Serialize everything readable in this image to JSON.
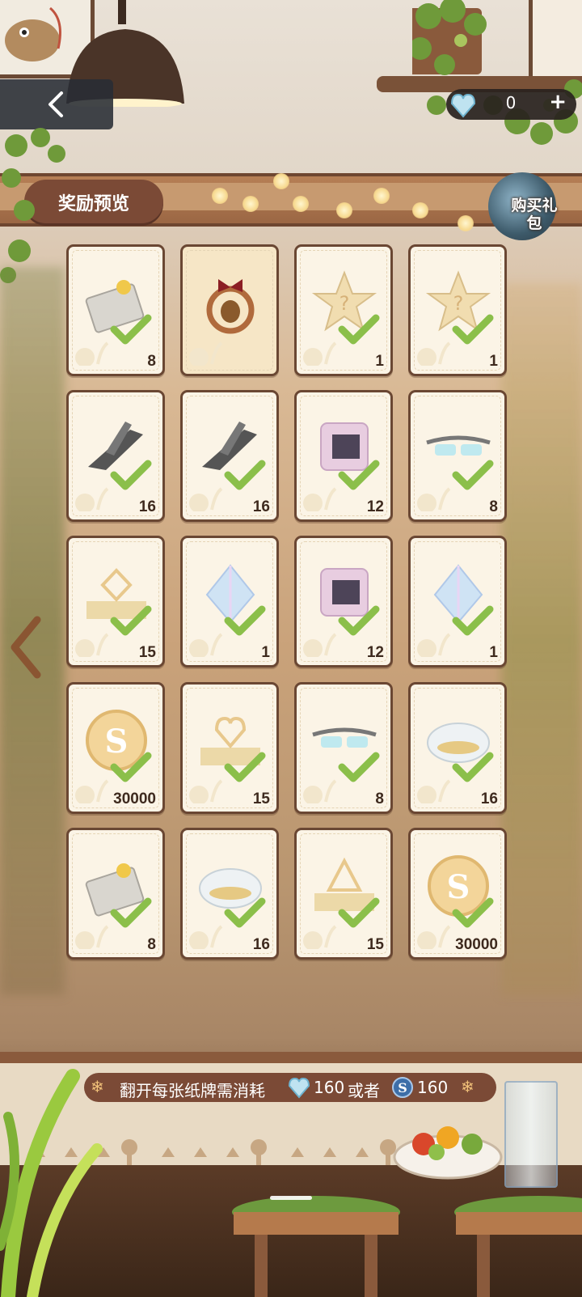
{
  "header": {
    "title": "奖励预览",
    "currency_value": "0",
    "currency_plus": "+",
    "buy_gift_label": "购买礼包"
  },
  "colors": {
    "card_border": "#6a4733",
    "card_bg": "#fbf4e6",
    "check_green": "#7cb342",
    "pill_brown": "#7b4a36"
  },
  "rewards": [
    {
      "icon": "book-icon",
      "qty": "8",
      "collected": true
    },
    {
      "icon": "wreath-featured-icon",
      "qty": "",
      "collected": false
    },
    {
      "icon": "mystery-star-icon",
      "qty": "1",
      "collected": true
    },
    {
      "icon": "mystery-star-icon",
      "qty": "1",
      "collected": true
    },
    {
      "icon": "multi-tool-icon",
      "qty": "16",
      "collected": true
    },
    {
      "icon": "multi-tool-icon",
      "qty": "16",
      "collected": true
    },
    {
      "icon": "chip-card-icon",
      "qty": "12",
      "collected": true
    },
    {
      "icon": "glasses-icon",
      "qty": "8",
      "collected": true
    },
    {
      "icon": "diamond-token-icon",
      "qty": "15",
      "collected": true
    },
    {
      "icon": "crystal-icon",
      "qty": "1",
      "collected": true
    },
    {
      "icon": "chip-card-icon",
      "qty": "12",
      "collected": true
    },
    {
      "icon": "crystal-icon",
      "qty": "1",
      "collected": true
    },
    {
      "icon": "s-coin-icon",
      "qty": "30000",
      "collected": true
    },
    {
      "icon": "heart-token-icon",
      "qty": "15",
      "collected": true
    },
    {
      "icon": "glasses-icon",
      "qty": "8",
      "collected": true
    },
    {
      "icon": "food-dome-icon",
      "qty": "16",
      "collected": true
    },
    {
      "icon": "book-icon",
      "qty": "8",
      "collected": true
    },
    {
      "icon": "food-dome-icon",
      "qty": "16",
      "collected": true
    },
    {
      "icon": "triangle-token-icon",
      "qty": "15",
      "collected": true
    },
    {
      "icon": "s-coin-icon",
      "qty": "30000",
      "collected": true
    }
  ],
  "footer": {
    "cost_prefix": "翻开每张纸牌需消耗",
    "cost_gem": "160",
    "cost_or": "或者",
    "cost_coin": "160"
  }
}
